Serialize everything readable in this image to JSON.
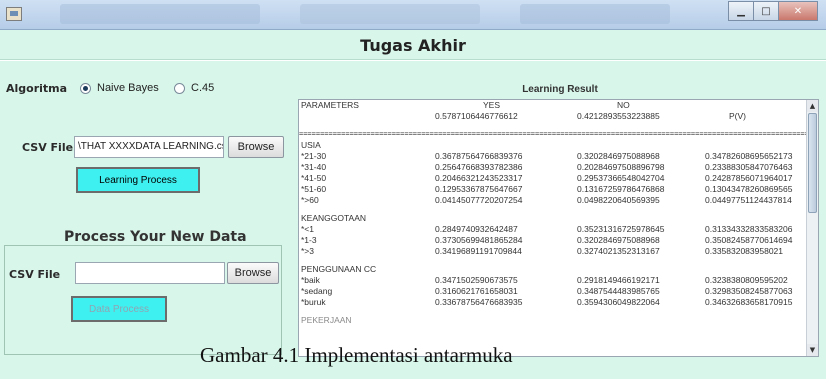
{
  "header": {
    "title": "Tugas Akhir"
  },
  "algorithm": {
    "label": "Algoritma",
    "options": [
      {
        "label": "Naive Bayes",
        "selected": true
      },
      {
        "label": "C.45",
        "selected": false
      }
    ]
  },
  "training": {
    "csv_label": "CSV File",
    "csv_value": "\\THAT XXXXDATA LEARNING.csv",
    "browse_label": "Browse",
    "process_label": "Learning Process"
  },
  "new_data": {
    "section_title": "Process Your New Data",
    "csv_label": "CSV File",
    "csv_value": "",
    "browse_label": "Browse",
    "process_label": "Data Process"
  },
  "result": {
    "title": "Learning Result",
    "header": {
      "col1": "PARAMETERS",
      "col2": "YES",
      "col3": "NO"
    },
    "priors": {
      "yes": "0.5787106446776612",
      "no": "0.4212893553223885",
      "label": "P(V)"
    },
    "rule": "=================================================================================================================================",
    "groups": [
      {
        "name": "USIA",
        "rows": [
          {
            "param": "*21-30",
            "yes": "0.36787564766839376",
            "no": "0.3202846975088968",
            "pv": "0.34782608695652173"
          },
          {
            "param": "*31-40",
            "yes": "0.25647668393782386",
            "no": "0.20284697508896798",
            "pv": "0.23388305847076463"
          },
          {
            "param": "*41-50",
            "yes": "0.20466321243523317",
            "no": "0.29537366548042704",
            "pv": "0.24287856071964017"
          },
          {
            "param": "*51-60",
            "yes": "0.12953367875647667",
            "no": "0.13167259786476868",
            "pv": "0.13043478260869565"
          },
          {
            "param": "*>60",
            "yes": "0.04145077720207254",
            "no": "0.0498220640569395",
            "pv": "0.04497751124437814"
          }
        ]
      },
      {
        "name": "KEANGGOTAAN",
        "rows": [
          {
            "param": "*<1",
            "yes": "0.2849740932642487",
            "no": "0.35231316725978645",
            "pv": "0.31334332833583206"
          },
          {
            "param": "*1-3",
            "yes": "0.37305699481865284",
            "no": "0.3202846975088968",
            "pv": "0.35082458770614694"
          },
          {
            "param": "*>3",
            "yes": "0.34196891191709844",
            "no": "0.3274021352313167",
            "pv": "0.335832083958021"
          }
        ]
      },
      {
        "name": "PENGGUNAAN CC",
        "rows": [
          {
            "param": "*baik",
            "yes": "0.3471502590673575",
            "no": "0.2918149466192171",
            "pv": "0.3238380809595202"
          },
          {
            "param": "*sedang",
            "yes": "0.3160621761658031",
            "no": "0.3487544483985765",
            "pv": "0.32983508245877063"
          },
          {
            "param": "*buruk",
            "yes": "0.33678756476683935",
            "no": "0.3594306049822064",
            "pv": "0.34632683658170915"
          }
        ]
      }
    ],
    "truncated_label": "PEKERJAAN"
  },
  "caption": "Gambar 4.1 Implementasi antarmuka",
  "window": {
    "minimize_glyph": "▁",
    "maximize_glyph": "□",
    "close_glyph": "✕",
    "scroll_up_glyph": "▲",
    "scroll_down_glyph": "▼"
  }
}
